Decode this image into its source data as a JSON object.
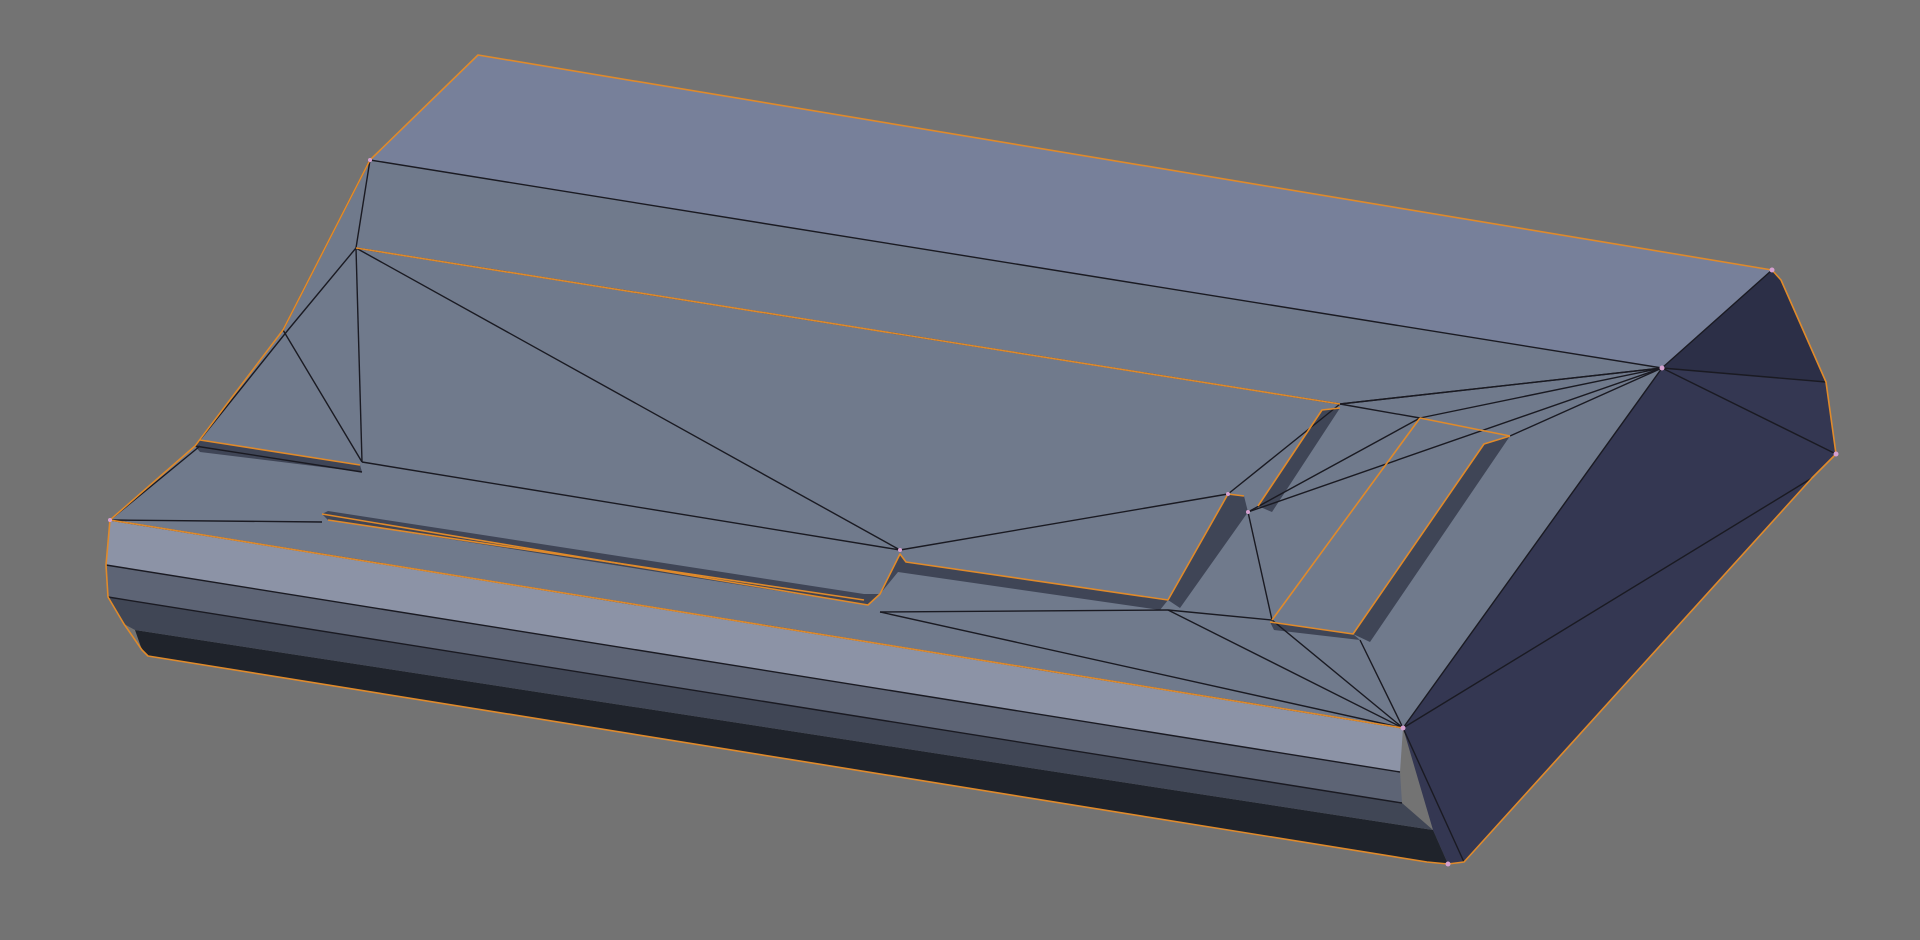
{
  "viewport": {
    "background_color": "#737373",
    "mode": "edit-mode-wireframe-over-solid",
    "object": "beveled-box-mesh-with-recessed-slots"
  },
  "colors": {
    "top_face": "#707a8c",
    "top_face_light": "#77809a",
    "front_face_light": "#8c93a6",
    "front_face_mid": "#5d6475",
    "front_face_dark": "#404655",
    "bottom_edge": "#1f232b",
    "right_face": "#343752",
    "right_face_dark": "#2c2f47",
    "slot_wall_dark": "#3f4556",
    "wire_edge": "#1a1a22",
    "selected_edge": "#e08a2a",
    "selected_vertex": "#d6a0d0"
  }
}
